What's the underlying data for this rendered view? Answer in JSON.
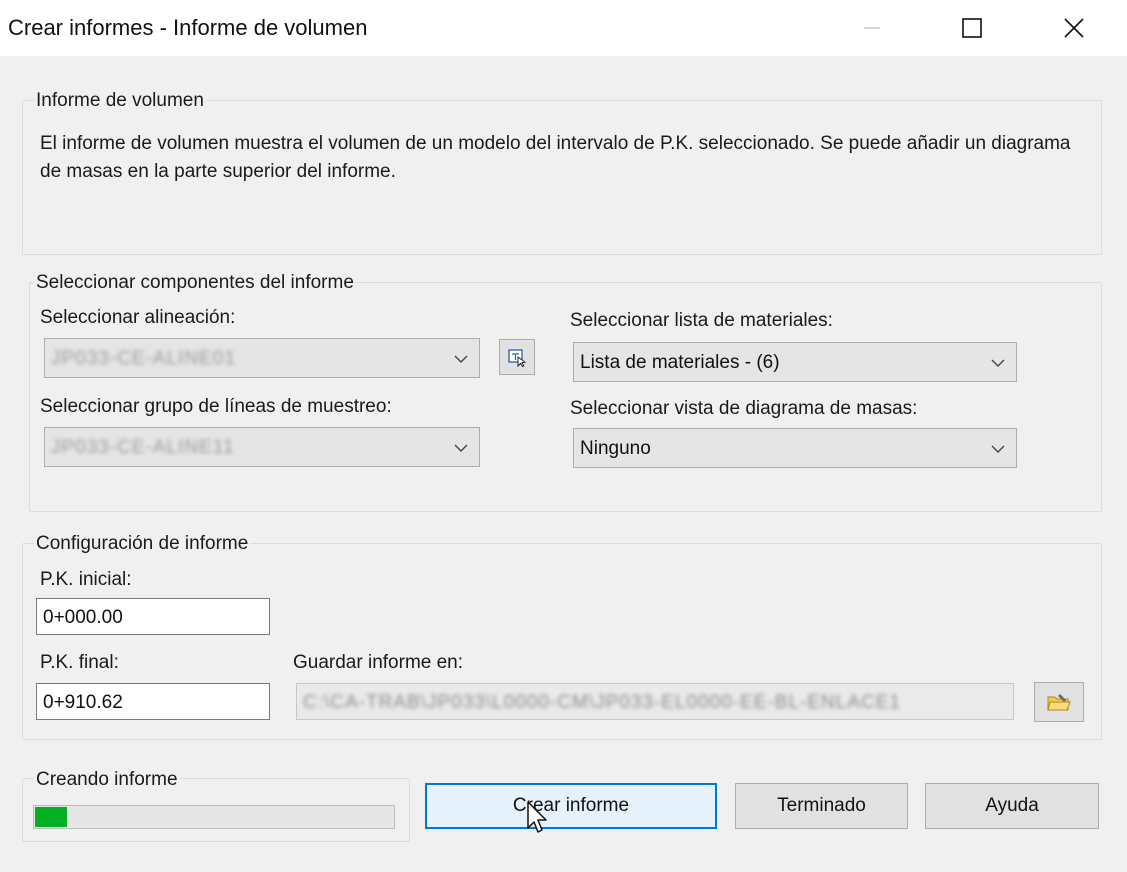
{
  "window": {
    "title": "Crear informes - Informe de volumen"
  },
  "report_info": {
    "group_label": "Informe de volumen",
    "description": "El informe de volumen muestra el volumen de un modelo del intervalo de P.K. seleccionado. Se puede añadir un diagrama de masas en la parte superior del informe."
  },
  "components": {
    "group_label": "Seleccionar componentes del informe",
    "alignment_label": "Seleccionar alineación:",
    "alignment_value": "JP033-CE-ALINE01",
    "sample_lines_label": "Seleccionar grupo de líneas de muestreo:",
    "sample_lines_value": "JP033-CE-ALINE11",
    "material_list_label": "Seleccionar lista de materiales:",
    "material_list_value": "Lista de materiales - (6)",
    "mass_haul_label": "Seleccionar vista de diagrama de masas:",
    "mass_haul_value": "Ninguno"
  },
  "settings": {
    "group_label": "Configuración de informe",
    "start_station_label": "P.K. inicial:",
    "start_station_value": "0+000.00",
    "end_station_label": "P.K. final:",
    "end_station_value": "0+910.62",
    "save_label": "Guardar informe en:",
    "save_path": "C:\\CA-TRAB\\JP033\\L0000-CM\\JP033-EL0000-EE-BL-ENLACE1"
  },
  "progress": {
    "label": "Creando informe",
    "fraction": 0.09
  },
  "buttons": {
    "create": "Crear informe",
    "done": "Terminado",
    "help": "Ayuda"
  },
  "colors": {
    "progress_fill": "#06b025",
    "focus_border": "#0078d7"
  },
  "icons": {
    "pick_alignment": "pick-from-drawing-icon",
    "browse_folder": "folder-browse-icon"
  }
}
